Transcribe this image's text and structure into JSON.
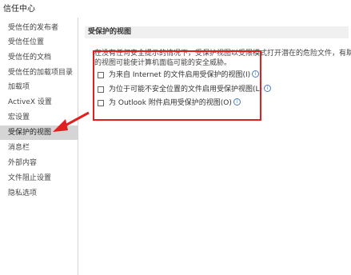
{
  "window": {
    "title": "信任中心"
  },
  "sidebar": {
    "items": [
      {
        "label": "受信任的发布者"
      },
      {
        "label": "受信任位置"
      },
      {
        "label": "受信任的文档"
      },
      {
        "label": "受信任的加载项目录"
      },
      {
        "label": "加载项"
      },
      {
        "label": "ActiveX 设置"
      },
      {
        "label": "宏设置"
      },
      {
        "label": "受保护的视图"
      },
      {
        "label": "消息栏"
      },
      {
        "label": "外部内容"
      },
      {
        "label": "文件阻止设置"
      },
      {
        "label": "隐私选项"
      }
    ],
    "active_index": 7
  },
  "main": {
    "section_title": "受保护的视图",
    "description_line1": "在没有任何安全提示的情况下，受保护视图以受限模式打开潜在的危险文件，有助于最",
    "description_line2": "的视图可能使计算机面临可能的安全威胁。",
    "options": [
      {
        "label": "为来自 Internet 的文件启用受保护的视图(I)",
        "checked": false,
        "info_icon": true
      },
      {
        "label": "为位于可能不安全位置的文件启用受保护视图(L)",
        "checked": false,
        "info_icon": true
      },
      {
        "label": "为 Outlook 附件启用受保护的视图(O)",
        "checked": false,
        "info_icon": true
      }
    ]
  },
  "annotations": {
    "highlight_color": "#e02020",
    "arrow_color": "#e02020"
  }
}
